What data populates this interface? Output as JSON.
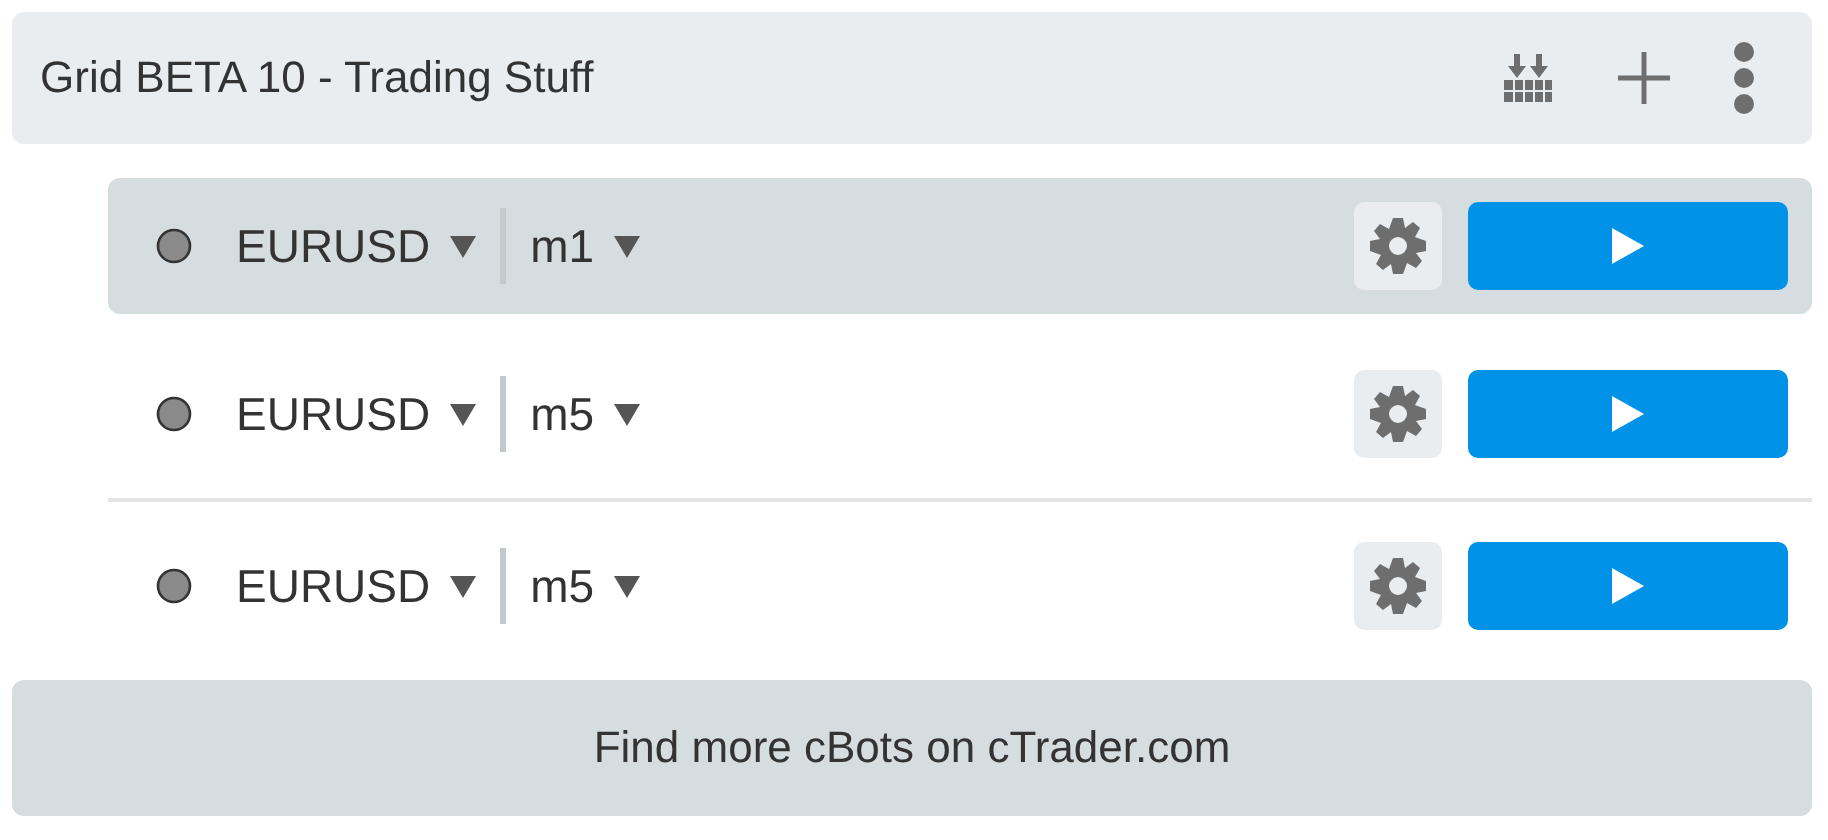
{
  "header": {
    "title": "Grid BETA 10 - Trading Stuff"
  },
  "instances": [
    {
      "symbol": "EURUSD",
      "timeframe": "m1",
      "selected": true
    },
    {
      "symbol": "EURUSD",
      "timeframe": "m5",
      "selected": false
    },
    {
      "symbol": "EURUSD",
      "timeframe": "m5",
      "selected": false
    }
  ],
  "footer": {
    "link": "Find more cBots on cTrader.com"
  }
}
